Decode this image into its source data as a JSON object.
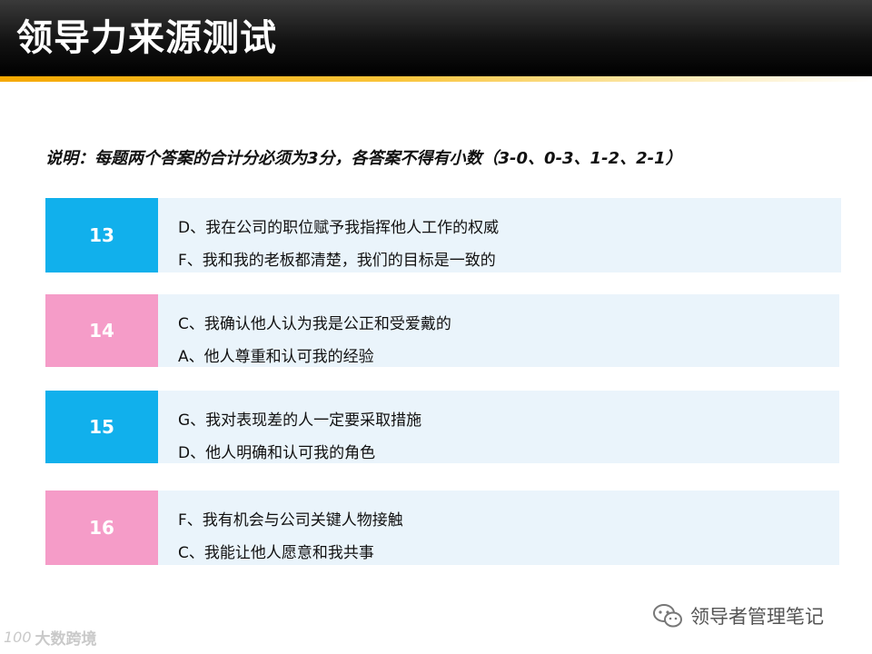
{
  "header": {
    "title": "领导力来源测试"
  },
  "note": "说明：每题两个答案的合计分必须为3分，各答案不得有小数（3-0、0-3、1-2、2-1）",
  "colors": {
    "blue": "#11b0ec",
    "pink": "#f59cc8",
    "card_bg": "#eaf4fb"
  },
  "questions": [
    {
      "num": "13",
      "opt1": "D、我在公司的职位赋予我指挥他人工作的权威",
      "opt2": "F、我和我的老板都清楚，我们的目标是一致的"
    },
    {
      "num": "14",
      "opt1": "C、我确认他人认为我是公正和受爱戴的",
      "opt2": "A、他人尊重和认可我的经验"
    },
    {
      "num": "15",
      "opt1": "G、我对表现差的人一定要采取措施",
      "opt2": "D、他人明确和认可我的角色"
    },
    {
      "num": "16",
      "opt1": "F、我有机会与公司关键人物接触",
      "opt2": "C、我能让他人愿意和我共事"
    }
  ],
  "watermark_right": {
    "icon": "wechat-icon",
    "text": "领导者管理笔记"
  },
  "watermark_left": {
    "logo": "100",
    "text": "大数跨境"
  }
}
